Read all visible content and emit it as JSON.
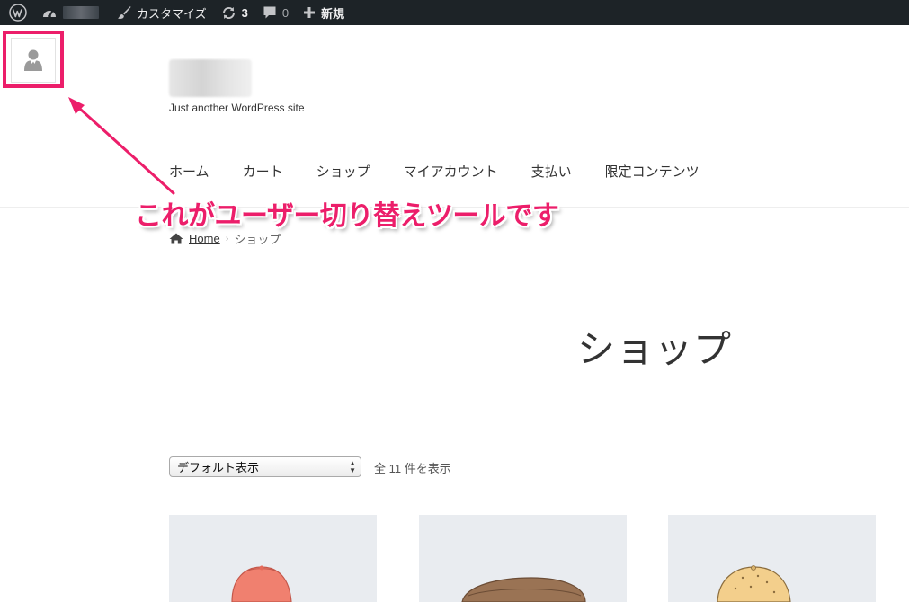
{
  "adminbar": {
    "customize_label": "カスタマイズ",
    "updates_count": "3",
    "comments_count": "0",
    "new_label": "新規"
  },
  "header": {
    "tagline": "Just another WordPress site"
  },
  "nav": {
    "items": [
      {
        "label": "ホーム"
      },
      {
        "label": "カート"
      },
      {
        "label": "ショップ"
      },
      {
        "label": "マイアカウント"
      },
      {
        "label": "支払い"
      },
      {
        "label": "限定コンテンツ"
      }
    ]
  },
  "annotation": {
    "text": "これがユーザー切り替えツールです",
    "color": "#ec1e6a"
  },
  "breadcrumb": {
    "home_label": "Home",
    "current_label": "ショップ"
  },
  "page": {
    "title": "ショップ"
  },
  "sorting": {
    "selected": "デフォルト表示",
    "result_count": "全 11 件を表示"
  },
  "products": [
    {
      "icon": "cap-pink-icon"
    },
    {
      "icon": "belt-brown-icon"
    },
    {
      "icon": "cap-yellow-icon"
    }
  ]
}
